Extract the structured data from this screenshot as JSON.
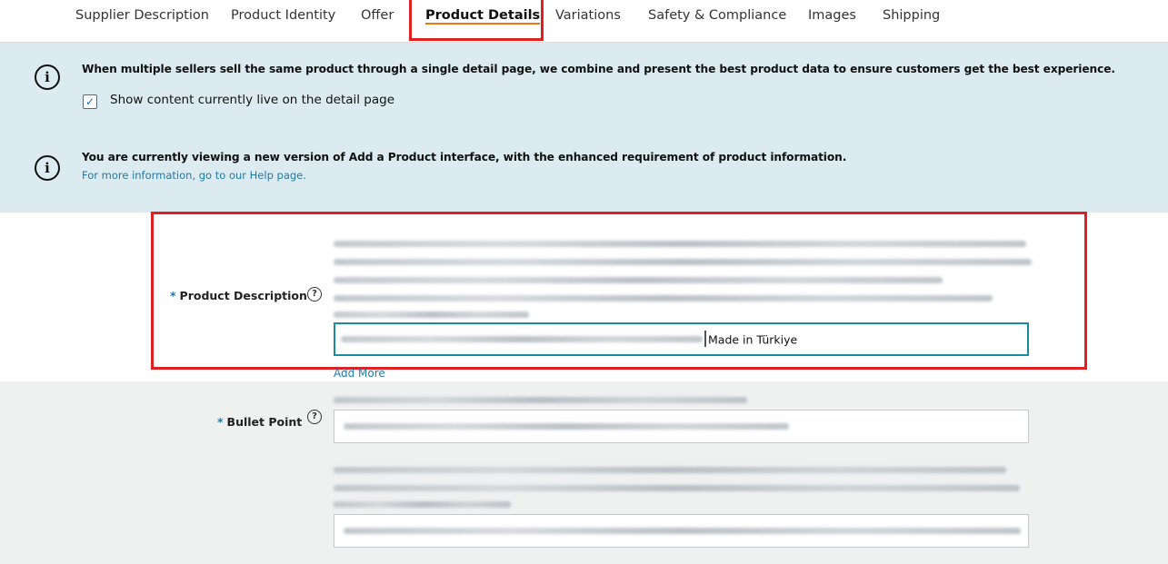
{
  "tabs": [
    {
      "label": "Supplier Description",
      "active": false
    },
    {
      "label": "Product Identity",
      "active": false
    },
    {
      "label": "Offer",
      "active": false
    },
    {
      "label": "Product Details",
      "active": true
    },
    {
      "label": "Variations",
      "active": false
    },
    {
      "label": "Safety & Compliance",
      "active": false
    },
    {
      "label": "Images",
      "active": false
    },
    {
      "label": "Shipping",
      "active": false
    }
  ],
  "banner": {
    "notice_1": "When multiple sellers sell the same product through a single detail page, we combine and present the best product data to ensure customers get the best experience.",
    "checkbox_label": "Show content currently live on the detail page",
    "checkbox_checked": true,
    "notice_2": "You are currently viewing a new version of Add a Product interface, with the enhanced requirement of product information.",
    "help_link": "For more information, go to our Help page.",
    "icon": "info-icon"
  },
  "form": {
    "product_description": {
      "label": "Product Description",
      "required_mark": "*",
      "input_visible_text": "Made in Türkiye",
      "add_more": "Add More"
    },
    "bullet_point": {
      "label": "Bullet Point",
      "required_mark": "*"
    },
    "help_icon": "question-circle-icon"
  },
  "colors": {
    "banner_bg": "#dcebef",
    "highlight_red": "#e02020",
    "link_blue": "#1f7aa8",
    "active_tab_underline": "#e47911",
    "focus_border": "#1b8aa3"
  }
}
